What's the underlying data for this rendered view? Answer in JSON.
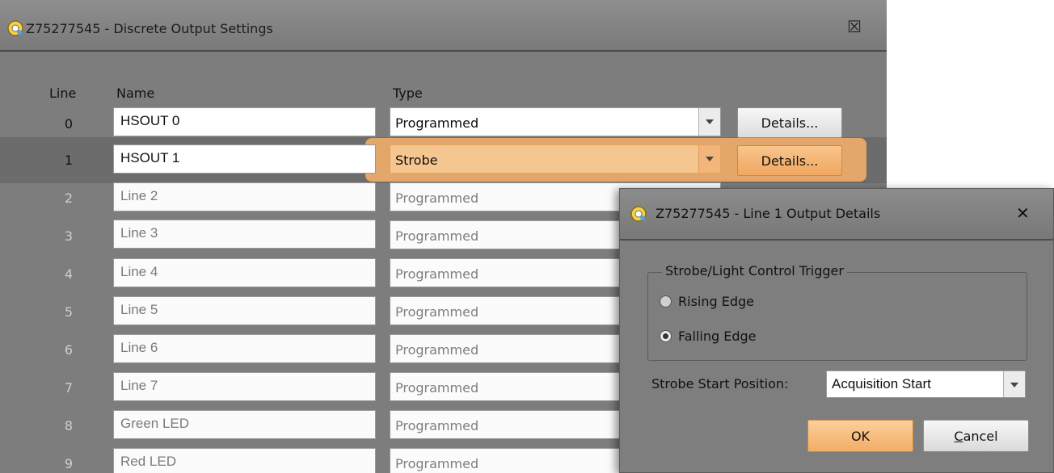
{
  "main_window": {
    "title": "Z75277545 - Discrete Output Settings",
    "close_glyph": "☒",
    "headers": {
      "line": "Line",
      "name": "Name",
      "type": "Type"
    },
    "details_label": "Details...",
    "rows": [
      {
        "line": "0",
        "name": "HSOUT 0",
        "type": "Programmed"
      },
      {
        "line": "1",
        "name": "HSOUT 1",
        "type": "Strobe"
      },
      {
        "line": "2",
        "name": "Line 2",
        "type": "Programmed"
      },
      {
        "line": "3",
        "name": "Line 3",
        "type": "Programmed"
      },
      {
        "line": "4",
        "name": "Line 4",
        "type": "Programmed"
      },
      {
        "line": "5",
        "name": "Line 5",
        "type": "Programmed"
      },
      {
        "line": "6",
        "name": "Line 6",
        "type": "Programmed"
      },
      {
        "line": "7",
        "name": "Line 7",
        "type": "Programmed"
      },
      {
        "line": "8",
        "name": "Green LED",
        "type": "Programmed"
      },
      {
        "line": "9",
        "name": "Red LED",
        "type": "Programmed"
      }
    ]
  },
  "details_dialog": {
    "title": "Z75277545 - Line 1 Output Details",
    "close_glyph": "✕",
    "group_label": "Strobe/Light Control Trigger",
    "radio_rising": "Rising Edge",
    "radio_falling": "Falling Edge",
    "selected_edge": "Falling Edge",
    "strobe_start_label": "Strobe Start Position:",
    "strobe_start_value": "Acquisition Start",
    "ok_label": "OK",
    "cancel_first": "C",
    "cancel_rest": "ancel"
  },
  "colors": {
    "highlight": "#f7b268",
    "window_bg": "#7d7d7d",
    "active_row_bg": "#6c6c6c"
  }
}
